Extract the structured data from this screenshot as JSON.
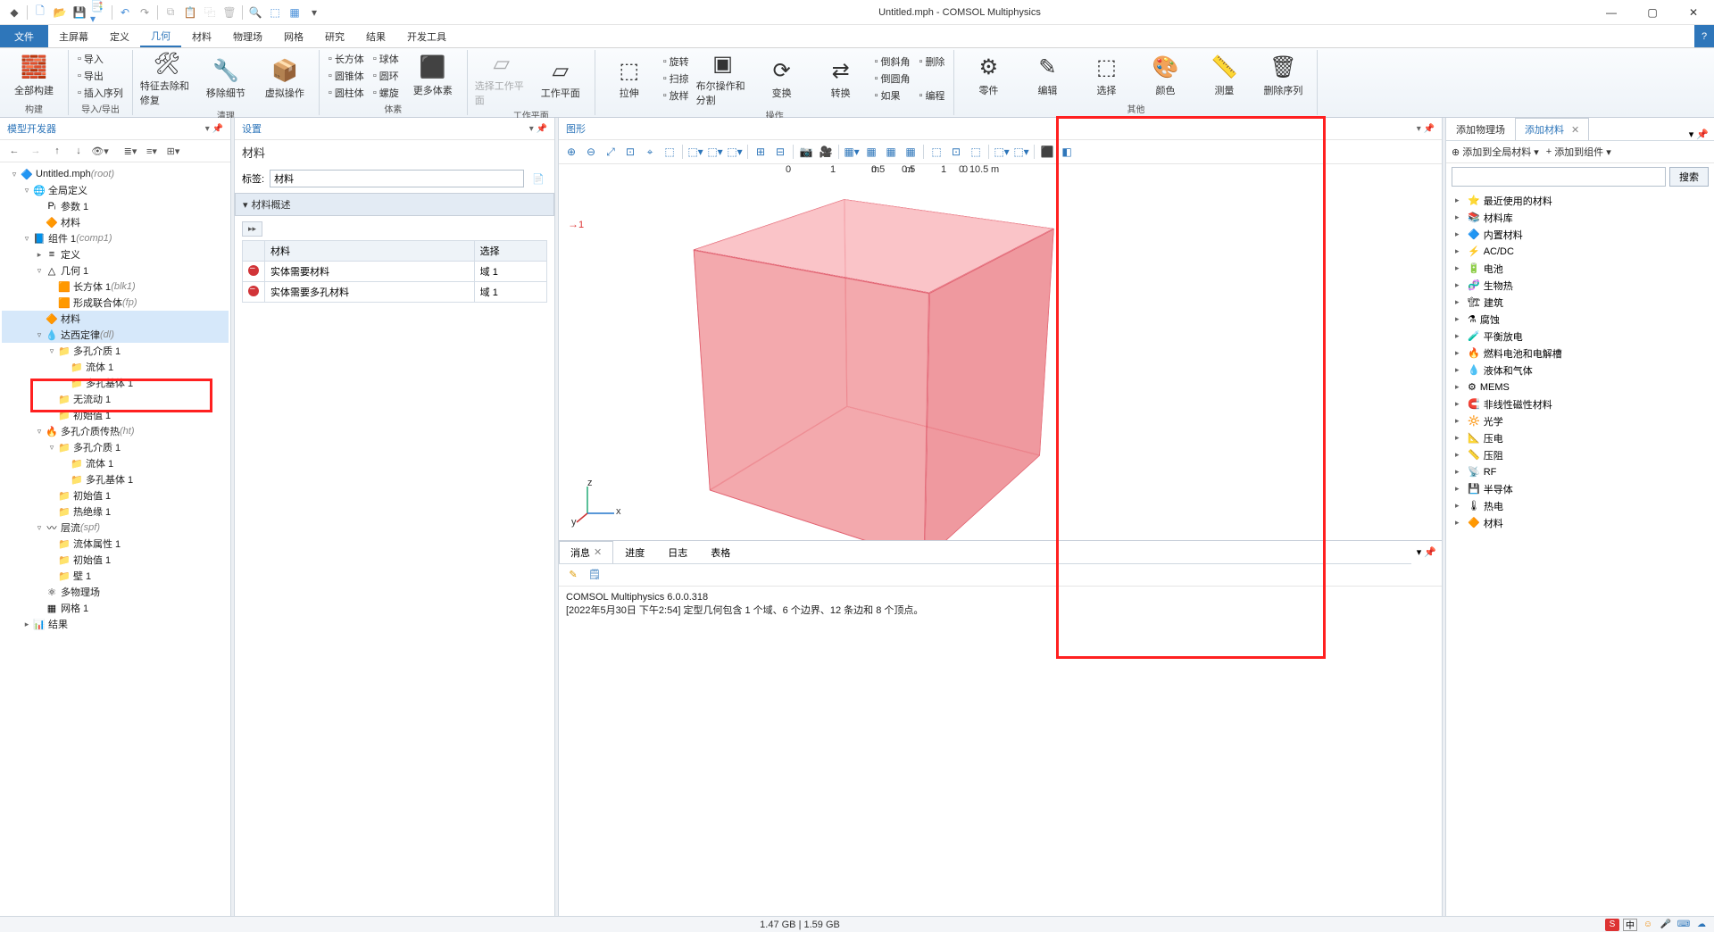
{
  "window": {
    "title": "Untitled.mph - COMSOL Multiphysics"
  },
  "menu": {
    "file": "文件",
    "tabs": [
      "主屏幕",
      "定义",
      "几何",
      "材料",
      "物理场",
      "网格",
      "研究",
      "结果",
      "开发工具"
    ],
    "active_index": 2,
    "help": "?"
  },
  "ribbon": {
    "groups": [
      {
        "label": "构建",
        "items": [
          {
            "label": "全部构建",
            "icon": "🧱"
          }
        ]
      },
      {
        "label": "导入/导出",
        "stacks": [
          [
            "导入",
            "导出",
            "插入序列"
          ]
        ]
      },
      {
        "label": "清理",
        "bigs": [
          {
            "label": "特征去除和修复",
            "icon": "🛠"
          },
          {
            "label": "移除细节",
            "icon": "🔧"
          },
          {
            "label": "虚拟操作",
            "icon": "📦"
          }
        ]
      },
      {
        "label": "体素",
        "stacks": [
          [
            "长方体",
            "圆锥体",
            "圆柱体"
          ],
          [
            "球体",
            "圆环",
            "螺旋"
          ]
        ],
        "last": {
          "label": "更多体素",
          "icon": "⬛"
        }
      },
      {
        "label": "工作平面",
        "bigs": [
          {
            "label": "选择工作平面",
            "icon": "▱",
            "disabled": true
          },
          {
            "label": "工作平面",
            "icon": "▱"
          }
        ]
      },
      {
        "label": "操作",
        "bigs": [
          {
            "label": "拉伸",
            "icon": "⬚"
          }
        ],
        "stacks": [
          [
            "旋转",
            "扫掠",
            "放样"
          ]
        ],
        "more": [
          {
            "label": "布尔操作和分割",
            "icon": "▣"
          },
          {
            "label": "变换",
            "icon": "⟳"
          },
          {
            "label": "转换",
            "icon": "⇄"
          }
        ],
        "right_stacks": [
          [
            "倒斜角",
            "倒圆角",
            "如果"
          ],
          [
            "删除",
            "",
            "编程"
          ]
        ]
      },
      {
        "label": "其他",
        "bigs": [
          {
            "label": "零件",
            "icon": "⚙"
          },
          {
            "label": "编辑",
            "icon": "✎"
          },
          {
            "label": "选择",
            "icon": "⬚"
          },
          {
            "label": "颜色",
            "icon": "🎨"
          },
          {
            "label": "测量",
            "icon": "📏"
          },
          {
            "label": "删除序列",
            "icon": "🗑"
          }
        ]
      }
    ]
  },
  "panels": {
    "tree_title": "模型开发器",
    "settings_title": "设置",
    "settings_sub": "材料",
    "label_field": "标签:",
    "label_value": "材料",
    "section_title": "材料概述",
    "graphics_title": "图形",
    "add_physics_tab": "添加物理场",
    "add_material_tab": "添加材料",
    "add_to_global": "添加到全局材料",
    "add_to_component": "添加到组件",
    "search_btn": "搜索"
  },
  "tree": [
    {
      "d": 0,
      "tw": "▿",
      "ico": "🔷",
      "label": "Untitled.mph",
      "suffix": "(root)"
    },
    {
      "d": 1,
      "tw": "▿",
      "ico": "🌐",
      "label": "全局定义"
    },
    {
      "d": 2,
      "tw": "",
      "ico": "Pᵢ",
      "label": "参数 1"
    },
    {
      "d": 2,
      "tw": "",
      "ico": "🔶",
      "label": "材料"
    },
    {
      "d": 1,
      "tw": "▿",
      "ico": "📘",
      "label": "组件 1",
      "suffix": "(comp1)"
    },
    {
      "d": 2,
      "tw": "▸",
      "ico": "≡",
      "label": "定义"
    },
    {
      "d": 2,
      "tw": "▿",
      "ico": "△",
      "label": "几何 1"
    },
    {
      "d": 3,
      "tw": "",
      "ico": "🟧",
      "label": "长方体 1",
      "suffix": "(blk1)"
    },
    {
      "d": 3,
      "tw": "",
      "ico": "🟧",
      "label": "形成联合体",
      "suffix": "(fp)"
    },
    {
      "d": 2,
      "tw": "",
      "ico": "🔶",
      "label": "材料",
      "sel": true
    },
    {
      "d": 2,
      "tw": "▿",
      "ico": "💧",
      "label": "达西定律",
      "suffix": "(dl)",
      "sel": true
    },
    {
      "d": 3,
      "tw": "▿",
      "ico": "📁",
      "label": "多孔介质 1"
    },
    {
      "d": 4,
      "tw": "",
      "ico": "📁",
      "label": "流体 1"
    },
    {
      "d": 4,
      "tw": "",
      "ico": "📁",
      "label": "多孔基体 1"
    },
    {
      "d": 3,
      "tw": "",
      "ico": "📁",
      "label": "无流动 1"
    },
    {
      "d": 3,
      "tw": "",
      "ico": "📁",
      "label": "初始值 1"
    },
    {
      "d": 2,
      "tw": "▿",
      "ico": "🔥",
      "label": "多孔介质传热",
      "suffix": "(ht)"
    },
    {
      "d": 3,
      "tw": "▿",
      "ico": "📁",
      "label": "多孔介质 1"
    },
    {
      "d": 4,
      "tw": "",
      "ico": "📁",
      "label": "流体 1"
    },
    {
      "d": 4,
      "tw": "",
      "ico": "📁",
      "label": "多孔基体 1"
    },
    {
      "d": 3,
      "tw": "",
      "ico": "📁",
      "label": "初始值 1"
    },
    {
      "d": 3,
      "tw": "",
      "ico": "📁",
      "label": "热绝缘 1"
    },
    {
      "d": 2,
      "tw": "▿",
      "ico": "〰",
      "label": "层流",
      "suffix": "(spf)"
    },
    {
      "d": 3,
      "tw": "",
      "ico": "📁",
      "label": "流体属性 1"
    },
    {
      "d": 3,
      "tw": "",
      "ico": "📁",
      "label": "初始值 1"
    },
    {
      "d": 3,
      "tw": "",
      "ico": "📁",
      "label": "壁 1"
    },
    {
      "d": 2,
      "tw": "",
      "ico": "⚛",
      "label": "多物理场"
    },
    {
      "d": 2,
      "tw": "",
      "ico": "▦",
      "label": "网格 1"
    },
    {
      "d": 1,
      "tw": "▸",
      "ico": "📊",
      "label": "结果"
    }
  ],
  "mat_table": {
    "headers": [
      "",
      "材料",
      "选择"
    ],
    "rows": [
      [
        "stop",
        "实体需要材料",
        "域 1"
      ],
      [
        "stop",
        "实体需要多孔材料",
        "域 1"
      ]
    ]
  },
  "graphics": {
    "red_marker": "1",
    "axis_ticks": [
      "0",
      "0.5",
      "1"
    ],
    "unit": "m",
    "triad": {
      "x": "x",
      "y": "y",
      "z": "z"
    }
  },
  "matlib": [
    {
      "ico": "⭐",
      "label": "最近使用的材料"
    },
    {
      "ico": "📚",
      "label": "材料库"
    },
    {
      "ico": "🔷",
      "label": "内置材料"
    },
    {
      "ico": "⚡",
      "label": "AC/DC"
    },
    {
      "ico": "🔋",
      "label": "电池"
    },
    {
      "ico": "🧬",
      "label": "生物热"
    },
    {
      "ico": "🏗",
      "label": "建筑"
    },
    {
      "ico": "⚗",
      "label": "腐蚀"
    },
    {
      "ico": "🧪",
      "label": "平衡放电"
    },
    {
      "ico": "🔥",
      "label": "燃料电池和电解槽"
    },
    {
      "ico": "💧",
      "label": "液体和气体"
    },
    {
      "ico": "⚙",
      "label": "MEMS"
    },
    {
      "ico": "🧲",
      "label": "非线性磁性材料"
    },
    {
      "ico": "🔆",
      "label": "光学"
    },
    {
      "ico": "📐",
      "label": "压电"
    },
    {
      "ico": "📏",
      "label": "压阻"
    },
    {
      "ico": "📡",
      "label": "RF"
    },
    {
      "ico": "💾",
      "label": "半导体"
    },
    {
      "ico": "🌡",
      "label": "热电"
    },
    {
      "ico": "🔶",
      "label": "材料"
    }
  ],
  "messages": {
    "tabs": [
      "消息",
      "进度",
      "日志",
      "表格"
    ],
    "active": 0,
    "lines": [
      "COMSOL Multiphysics 6.0.0.318",
      "[2022年5月30日 下午2:54] 定型几何包含 1 个域、6 个边界、12 条边和 8 个顶点。"
    ]
  },
  "status": {
    "memory": "1.47 GB | 1.59 GB",
    "ime": "中"
  }
}
